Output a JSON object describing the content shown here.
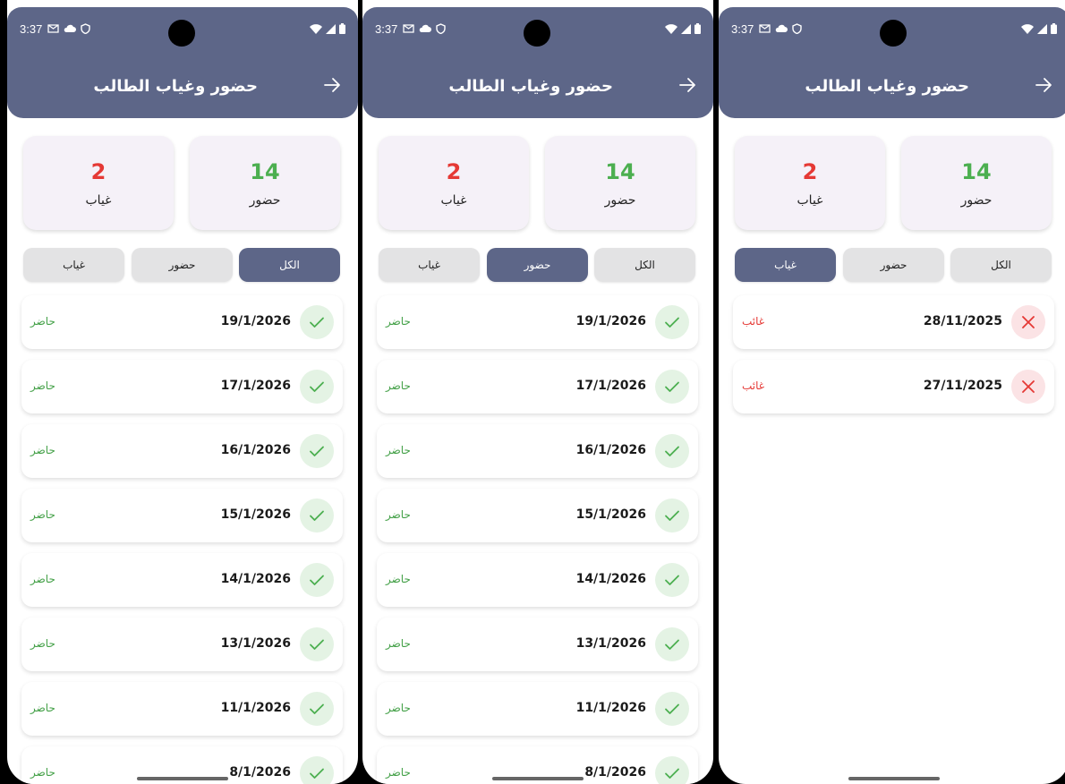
{
  "status_bar": {
    "time": "3:37"
  },
  "screens": [
    {
      "title": "حضور وغياب الطالب",
      "stats": {
        "present_count": "14",
        "present_label": "حضور",
        "absent_count": "2",
        "absent_label": "غياب"
      },
      "tabs": [
        {
          "label": "الكل"
        },
        {
          "label": "حضور"
        },
        {
          "label": "غياب"
        }
      ],
      "active_tab": 0,
      "records": [
        {
          "date": "19/1/2026",
          "status": "حاضر",
          "type": "present"
        },
        {
          "date": "17/1/2026",
          "status": "حاضر",
          "type": "present"
        },
        {
          "date": "16/1/2026",
          "status": "حاضر",
          "type": "present"
        },
        {
          "date": "15/1/2026",
          "status": "حاضر",
          "type": "present"
        },
        {
          "date": "14/1/2026",
          "status": "حاضر",
          "type": "present"
        },
        {
          "date": "13/1/2026",
          "status": "حاضر",
          "type": "present"
        },
        {
          "date": "11/1/2026",
          "status": "حاضر",
          "type": "present"
        },
        {
          "date": "8/1/2026",
          "status": "حاضر",
          "type": "present"
        }
      ]
    },
    {
      "title": "حضور وغياب الطالب",
      "stats": {
        "present_count": "14",
        "present_label": "حضور",
        "absent_count": "2",
        "absent_label": "غياب"
      },
      "tabs": [
        {
          "label": "الكل"
        },
        {
          "label": "حضور"
        },
        {
          "label": "غياب"
        }
      ],
      "active_tab": 1,
      "records": [
        {
          "date": "19/1/2026",
          "status": "حاضر",
          "type": "present"
        },
        {
          "date": "17/1/2026",
          "status": "حاضر",
          "type": "present"
        },
        {
          "date": "16/1/2026",
          "status": "حاضر",
          "type": "present"
        },
        {
          "date": "15/1/2026",
          "status": "حاضر",
          "type": "present"
        },
        {
          "date": "14/1/2026",
          "status": "حاضر",
          "type": "present"
        },
        {
          "date": "13/1/2026",
          "status": "حاضر",
          "type": "present"
        },
        {
          "date": "11/1/2026",
          "status": "حاضر",
          "type": "present"
        },
        {
          "date": "8/1/2026",
          "status": "حاضر",
          "type": "present"
        }
      ]
    },
    {
      "title": "حضور وغياب الطالب",
      "stats": {
        "present_count": "14",
        "present_label": "حضور",
        "absent_count": "2",
        "absent_label": "غياب"
      },
      "tabs": [
        {
          "label": "الكل"
        },
        {
          "label": "حضور"
        },
        {
          "label": "غياب"
        }
      ],
      "active_tab": 2,
      "records": [
        {
          "date": "28/11/2025",
          "status": "غائب",
          "type": "absent"
        },
        {
          "date": "27/11/2025",
          "status": "غائب",
          "type": "absent"
        }
      ]
    }
  ],
  "colors": {
    "appbar": "#5d6688",
    "present": "#4caf50",
    "absent": "#e53935"
  }
}
